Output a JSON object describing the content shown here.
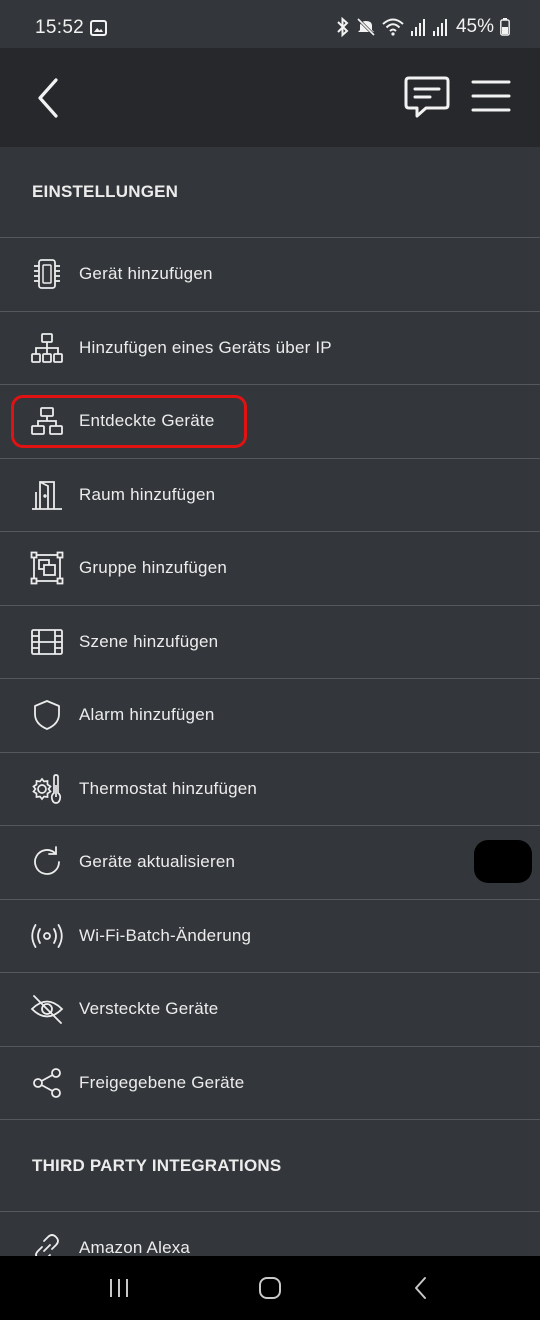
{
  "status_bar": {
    "time": "15:52",
    "battery": "45%",
    "icons": [
      "gallery-icon",
      "bluetooth-icon",
      "mute-icon",
      "wifi-icon",
      "signal-icon",
      "signal-icon",
      "battery-icon"
    ]
  },
  "header": {
    "back_icon": "chevron-left-icon",
    "chat_icon": "chat-icon",
    "menu_icon": "hamburger-menu-icon"
  },
  "settings": {
    "title": "EINSTELLUNGEN",
    "items": [
      {
        "label": "Gerät hinzufügen",
        "icon": "device-chip-icon"
      },
      {
        "label": "Hinzufügen eines Geräts über IP",
        "icon": "network-tree-icon"
      },
      {
        "label": "Entdeckte Geräte",
        "icon": "network-tree-icon",
        "highlighted": true
      },
      {
        "label": "Raum hinzufügen",
        "icon": "door-room-icon"
      },
      {
        "label": "Gruppe hinzufügen",
        "icon": "group-icon"
      },
      {
        "label": "Szene hinzufügen",
        "icon": "film-icon"
      },
      {
        "label": "Alarm hinzufügen",
        "icon": "shield-icon"
      },
      {
        "label": "Thermostat hinzufügen",
        "icon": "thermostat-icon"
      },
      {
        "label": "Geräte aktualisieren",
        "icon": "refresh-icon"
      },
      {
        "label": "Wi-Fi-Batch-Änderung",
        "icon": "broadcast-icon"
      },
      {
        "label": "Versteckte Geräte",
        "icon": "eye-off-icon"
      },
      {
        "label": "Freigegebene Geräte",
        "icon": "share-icon"
      }
    ]
  },
  "third_party": {
    "title": "THIRD PARTY INTEGRATIONS",
    "items": [
      {
        "label": "Amazon Alexa",
        "icon": "link-icon"
      }
    ]
  },
  "colors": {
    "background": "#33363a",
    "header": "#26282b",
    "highlight": "#e11212",
    "divider": "#55595e"
  }
}
